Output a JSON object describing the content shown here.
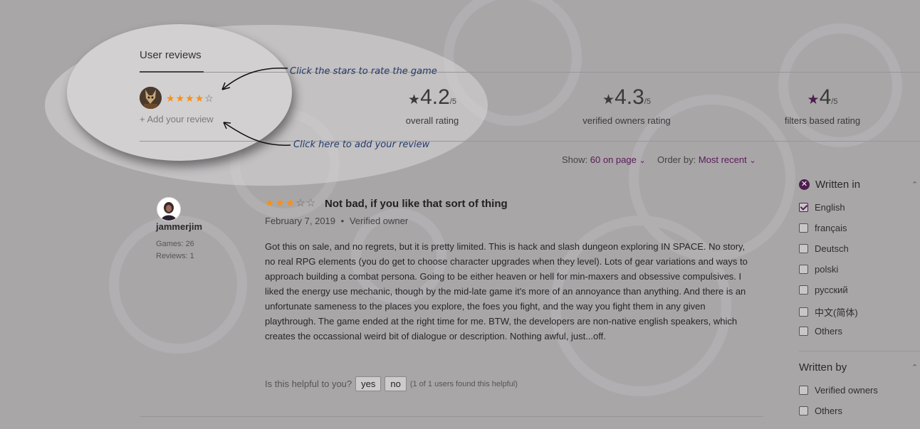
{
  "spotlight": {
    "tab_title": "User reviews",
    "user_rating_stars": 4,
    "add_review_label": "+ Add your review",
    "annotation_stars": "Click the stars to rate the game",
    "annotation_add": "Click here to add your review"
  },
  "ratings": [
    {
      "value": "4.2",
      "out_of": "/5",
      "label": "overall rating"
    },
    {
      "value": "4.3",
      "out_of": "/5",
      "label": "verified owners rating"
    },
    {
      "value": "4",
      "out_of": "/5",
      "label": "filters based rating"
    }
  ],
  "toolbar": {
    "show_label": "Show:",
    "show_value": "60 on page",
    "order_label": "Order by:",
    "order_value": "Most recent"
  },
  "review": {
    "username": "jammerjim",
    "games": "Games: 26",
    "reviews": "Reviews: 1",
    "stars": 3,
    "title": "Not bad, if you like that sort of thing",
    "date": "February 7, 2019",
    "verified": "Verified owner",
    "body": "Got this on sale, and no regrets, but it is pretty limited. This is hack and slash dungeon exploring IN SPACE. No story, no real RPG elements (you do get to choose character upgrades when they level). Lots of gear variations and ways to approach building a combat persona. Going to be either heaven or hell for min-maxers and obsessive compulsives. I liked the energy use mechanic, though by the mid-late game it's more of an annoyance than anything. And there is an unfortunate sameness to the places you explore, the foes you fight, and the way you fight them in any given playthrough. The game ended at the right time for me. BTW, the developers are non-native english speakers, which creates the occassional weird bit of dialogue or description. Nothing awful, just...off.",
    "helpful_question": "Is this helpful to you?",
    "yes_label": "yes",
    "no_label": "no",
    "helpful_note": "(1 of 1 users found this helpful)"
  },
  "filters": {
    "written_in": {
      "title": "Written in",
      "options": [
        {
          "label": "English",
          "checked": true
        },
        {
          "label": "français",
          "checked": false
        },
        {
          "label": "Deutsch",
          "checked": false
        },
        {
          "label": "polski",
          "checked": false
        },
        {
          "label": "русский",
          "checked": false
        },
        {
          "label": "中文(简体)",
          "checked": false
        },
        {
          "label": "Others",
          "checked": false
        }
      ]
    },
    "written_by": {
      "title": "Written by",
      "options": [
        {
          "label": "Verified owners",
          "checked": false
        },
        {
          "label": "Others",
          "checked": false
        }
      ]
    }
  },
  "colors": {
    "accent_purple": "#5a1a5a",
    "star_orange": "#f4911a",
    "annotation_blue": "#243c6a"
  }
}
